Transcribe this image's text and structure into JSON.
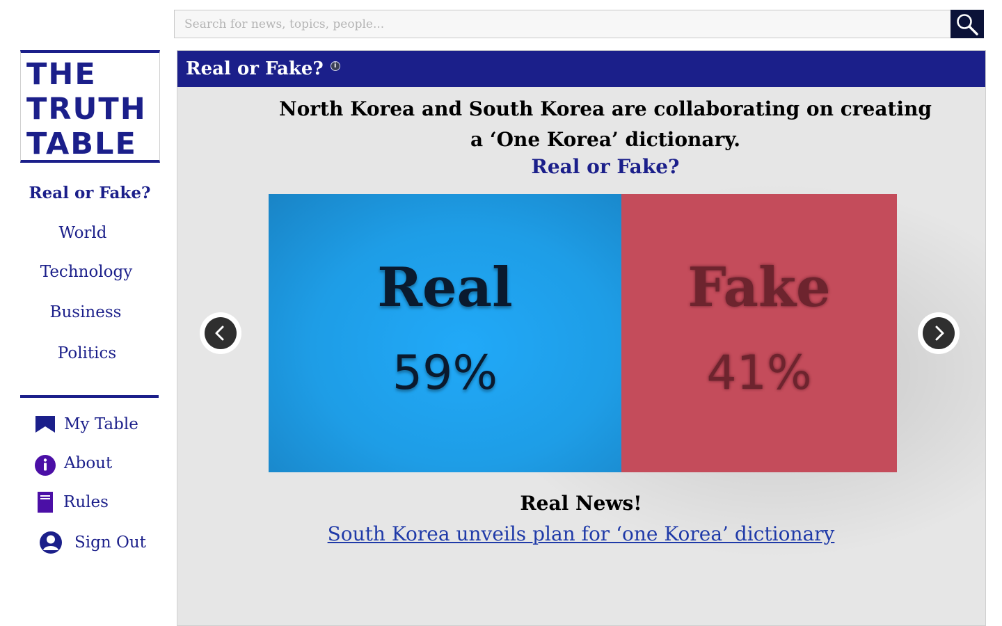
{
  "search": {
    "placeholder": "Search for news, topics, people..."
  },
  "logo": {
    "lines": [
      "THE",
      "TRUTH",
      "TABLE"
    ]
  },
  "nav": [
    {
      "label": "Real or Fake?",
      "active": true
    },
    {
      "label": "World"
    },
    {
      "label": "Technology"
    },
    {
      "label": "Business"
    },
    {
      "label": "Politics"
    }
  ],
  "utility": [
    {
      "label": "My Table",
      "icon": "bookmark-icon"
    },
    {
      "label": "About",
      "icon": "info-icon"
    },
    {
      "label": "Rules",
      "icon": "rulebook-icon"
    },
    {
      "label": "Sign Out",
      "icon": "user-icon"
    }
  ],
  "panel": {
    "title": "Real or Fake?",
    "headline": "North Korea and South Korea are collaborating on creating a ‘One Korea’ dictionary.",
    "question": "Real or Fake?",
    "real": {
      "label": "Real",
      "percent": "59%"
    },
    "fake": {
      "label": "Fake",
      "percent": "41%"
    },
    "result": "Real News!",
    "source_link": "South Korea unveils plan for ‘one Korea’ dictionary"
  },
  "colors": {
    "brand": "#1b1f8a",
    "real": "#1e9de6",
    "fake": "#c44c5b",
    "link": "#1f3aa8"
  }
}
